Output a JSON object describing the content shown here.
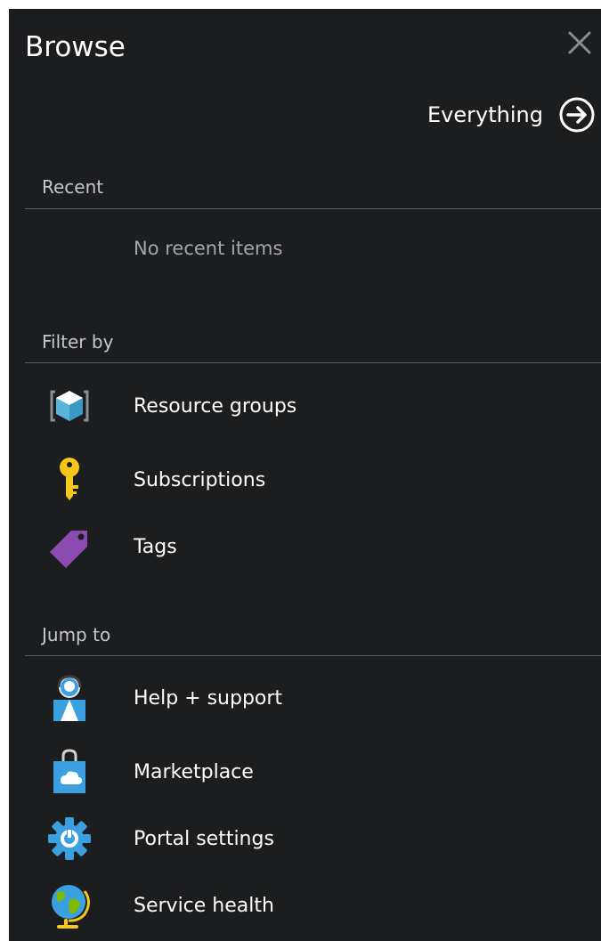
{
  "header": {
    "title": "Browse",
    "close_icon": "close-icon"
  },
  "everything_link": {
    "label": "Everything",
    "icon": "arrow-right-circle-icon"
  },
  "recent": {
    "heading": "Recent",
    "empty_text": "No recent items"
  },
  "filter_by": {
    "heading": "Filter by",
    "items": [
      {
        "label": "Resource groups",
        "icon": "resource-group-icon"
      },
      {
        "label": "Subscriptions",
        "icon": "key-icon"
      },
      {
        "label": "Tags",
        "icon": "tag-icon"
      }
    ]
  },
  "jump_to": {
    "heading": "Jump to",
    "items": [
      {
        "label": "Help + support",
        "icon": "help-support-icon"
      },
      {
        "label": "Marketplace",
        "icon": "marketplace-bag-icon"
      },
      {
        "label": "Portal settings",
        "icon": "gear-icon"
      },
      {
        "label": "Service health",
        "icon": "globe-icon"
      }
    ]
  },
  "colors": {
    "panel_background": "#1c1d1f",
    "text_primary": "#ffffff",
    "text_secondary": "#c6c7c9",
    "divider": "#5a5c60",
    "azure_blue": "#3ba0e0",
    "key_yellow": "#f6c718",
    "tag_purple": "#8a4bb0",
    "globe_green": "#7fba00"
  }
}
